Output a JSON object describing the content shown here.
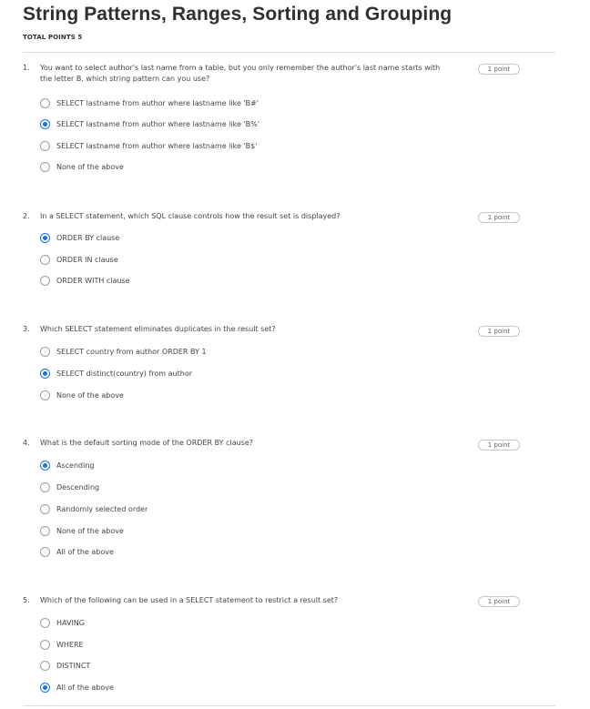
{
  "page": {
    "title": "String Patterns, Ranges, Sorting and Grouping",
    "total_points": "TOTAL POINTS 5"
  },
  "questions": [
    {
      "number": "1.",
      "text": "You want to select author's last name from a table, but you only remember the author's last name starts with the letter B, which string pattern can you use?",
      "points": "1 point",
      "selected": 1,
      "options": [
        "SELECT lastname from author where lastname like 'B#'",
        "SELECT lastname from author where lastname like 'B%'",
        "SELECT lastname from author where lastname like 'B$'",
        "None of the above"
      ]
    },
    {
      "number": "2.",
      "text": "In a SELECT statement, which SQL clause controls how the result set is displayed?",
      "points": "1 point",
      "selected": 0,
      "options": [
        "ORDER BY clause",
        "ORDER IN clause",
        "ORDER WITH clause"
      ]
    },
    {
      "number": "3.",
      "text": "Which SELECT statement eliminates duplicates in the result set?",
      "points": "1 point",
      "selected": 1,
      "options": [
        "SELECT country from author ORDER BY 1",
        "SELECT distinct(country) from author",
        "None of the above"
      ]
    },
    {
      "number": "4.",
      "text": "What is the default sorting mode of the ORDER BY clause?",
      "points": "1 point",
      "selected": 0,
      "options": [
        "Ascending",
        "Descending",
        "Randomly selected order",
        "None of the above",
        "All of the above"
      ]
    },
    {
      "number": "5.",
      "text": "Which of the following can be used in a SELECT statement to restrict a result set?",
      "points": "1 point",
      "selected": 3,
      "options": [
        "HAVING",
        "WHERE",
        "DISTINCT",
        "All of the above"
      ]
    }
  ],
  "colors": {
    "accent": "#1a73e8",
    "divider": "#dddddd",
    "title": "#2f2f2f"
  }
}
